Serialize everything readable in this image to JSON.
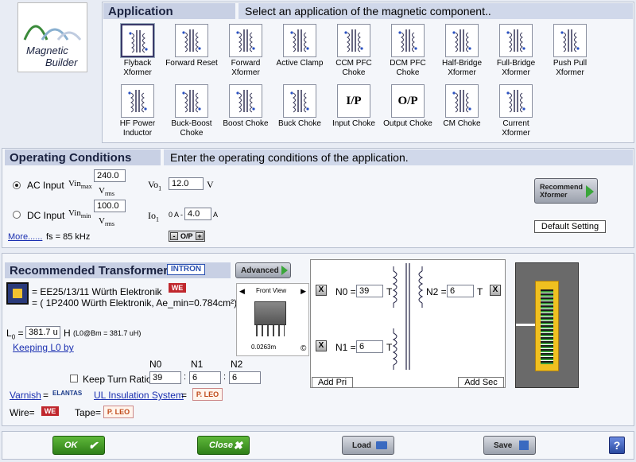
{
  "logo": {
    "line1": "Magnetic",
    "line2": "Builder"
  },
  "application": {
    "title": "Application",
    "desc": "Select an application of the magnetic component..",
    "items": [
      {
        "label": "Flyback\nXformer",
        "selected": true
      },
      {
        "label": "Forward Reset"
      },
      {
        "label": "Forward\nXformer"
      },
      {
        "label": "Active Clamp"
      },
      {
        "label": "CCM PFC\nChoke"
      },
      {
        "label": "DCM PFC\nChoke"
      },
      {
        "label": "Half-Bridge\nXformer"
      },
      {
        "label": "Full-Bridge\nXformer"
      },
      {
        "label": "Push Pull\nXformer"
      },
      {
        "label": "HF Power\nInductor"
      },
      {
        "label": "Buck-Boost\nChoke"
      },
      {
        "label": "Boost Choke"
      },
      {
        "label": "Buck Choke"
      },
      {
        "label": "Input Choke",
        "glyph": "I/P"
      },
      {
        "label": "Output Choke",
        "glyph": "O/P"
      },
      {
        "label": "CM Choke"
      },
      {
        "label": "Current\nXformer"
      }
    ]
  },
  "operating": {
    "title": "Operating Conditions",
    "desc": "Enter the operating conditions of the application.",
    "ac_label": "AC Input",
    "dc_label": "DC Input",
    "vinmax_sym": "Vin",
    "vinmax_sub": "max",
    "vinmin_sym": "Vin",
    "vinmin_sub": "min",
    "vrms": "V",
    "vrms_sub": "rms",
    "vinmax_value": "240.0",
    "vinmin_value": "100.0",
    "vo_sym": "Vo",
    "vo_sub": "1",
    "vo_value": "12.0",
    "vo_unit": "V",
    "io_sym": "Io",
    "io_sub": "1",
    "io_prefix": "0 A -",
    "io_value": "4.0",
    "io_unit": "A",
    "op_label": "O/P",
    "op_minus": "-",
    "op_plus": "+",
    "more_link": "More......",
    "fs_text": "fs = 85 kHz",
    "recommend_label": "Recommend\nXformer",
    "default_label": "Default Setting"
  },
  "recommended": {
    "title": "Recommended Transformer",
    "brand": "INTRON",
    "advanced_label": "Advanced",
    "core_text": "= EE25/13/11 Würth Elektronik",
    "core_text2": "= ( 1P2400 Würth Elektronik, Ae_min=0.784cm²)",
    "we_logo": "WE",
    "l0_label": "L",
    "l0_sub": "0",
    "l0_eq": "=",
    "l0_value": "381.7 u",
    "l0_unit": "H",
    "l0_note": "(L0@Bm = 381.7 uH)",
    "keeping_link": "Keeping L0 by",
    "front_view": "Front View",
    "dimension": "0.0263m",
    "copyright": "©",
    "n_headers": [
      "N0",
      "N1",
      "N2"
    ],
    "keep_turn_label": "Keep Turn Ratio",
    "n_values": [
      "39",
      "6",
      "6"
    ],
    "varnish_link": "Varnish",
    "varnish_eq": "=",
    "elantas": "ELANTAS",
    "ul_link": "UL Insulation System",
    "ul_eq": "=",
    "pleo": "P. LEO",
    "wire_label": "Wire=",
    "tape_label": "Tape=",
    "winding": {
      "n0_label": "N0 =",
      "n0_value": "39",
      "t0": "T",
      "n1_label": "N1 =",
      "n1_value": "6",
      "t1": "T",
      "n2_label": "N2 =",
      "n2_value": "6",
      "t2": "T",
      "add_pri": "Add Pri",
      "add_sec": "Add Sec",
      "x": "X"
    }
  },
  "footer": {
    "ok": "OK",
    "close": "Close",
    "load": "Load",
    "save": "Save",
    "help": "?"
  },
  "colors": {
    "accent": "#c8d0e4",
    "green": "#2f7f18",
    "link": "#1a2fb0"
  }
}
